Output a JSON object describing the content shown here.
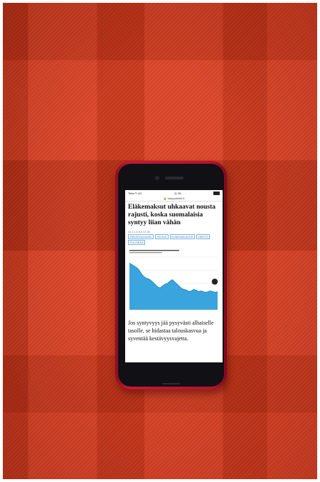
{
  "status_bar": {
    "carrier": "Telia FI 4G",
    "time": "11.35"
  },
  "browser": {
    "url": "kauppalehti.fi"
  },
  "article": {
    "headline": "Eläkemaksut uhkaavat nousta rajusti, koska suomalaisia syntyy liian vähän",
    "date": "28.10.2018 04:30",
    "tags": [
      "ERIKOISJULKAISU",
      "TALOUS",
      "ELÄKEVAKUUTUS",
      "VÄESTÖ",
      "POLITIIKKA"
    ],
    "body": "Jos syntyvyys jää pysyvästi alhaiselle tasolle, se hidastaa talouskasvua ja syventää kestävyysvajetta."
  },
  "chart_data": {
    "type": "area",
    "title": "",
    "series": [
      {
        "values": [
          62,
          60,
          58,
          56,
          53,
          48,
          44,
          42,
          41,
          39,
          36,
          33,
          30,
          29,
          32,
          34,
          35,
          38,
          40,
          37,
          34,
          31,
          28,
          27,
          26,
          24,
          25,
          27,
          26,
          24,
          25,
          24,
          23,
          24,
          25,
          24,
          23,
          24
        ]
      }
    ],
    "colors": {
      "fill": "#39a4dd",
      "line": "#1b7fc0",
      "marker": "#222222"
    },
    "grid": true
  }
}
